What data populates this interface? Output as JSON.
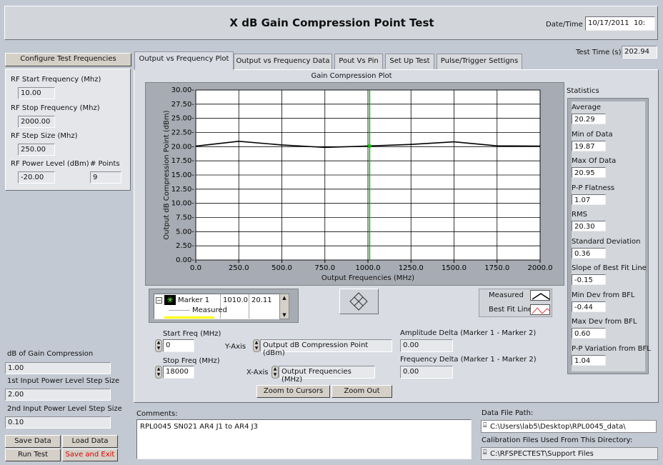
{
  "header": {
    "title": "X dB Gain Compression Point Test",
    "datetime_label": "Date/Time",
    "datetime_value": "10/17/2011  10:",
    "test_time_label": "Test Time (s)",
    "test_time_value": "202.94"
  },
  "config": {
    "button": "Configure Test Frequencies",
    "rf_start_label": "RF Start Frequency (Mhz)",
    "rf_start_value": "10.00",
    "rf_stop_label": "RF Stop Frequency (Mhz)",
    "rf_stop_value": "2000.00",
    "rf_step_label": "RF Step Size (Mhz)",
    "rf_step_value": "250.00",
    "rf_power_label": "RF Power Level (dBm)",
    "rf_power_value": "-20.00",
    "points_label": "# Points",
    "points_value": "9"
  },
  "tabs": [
    {
      "label": "Output vs Frequency Plot"
    },
    {
      "label": "Output vs Frequency Data"
    },
    {
      "label": "Pout Vs Pin"
    },
    {
      "label": "Set Up Test"
    },
    {
      "label": "Pulse/Trigger Settigns"
    }
  ],
  "plot": {
    "title": "Gain Compression Plot",
    "cursor_x": 1010
  },
  "chart_data": {
    "type": "line",
    "title": "Gain Compression Plot",
    "xlabel": "Output Frequencies (MHz)",
    "ylabel": "Output dB Compression Point (dBm)",
    "xlim": [
      0,
      2000
    ],
    "ylim": [
      0,
      30
    ],
    "x_ticks": [
      "0.0",
      "250.0",
      "500.0",
      "750.0",
      "1000.0",
      "1250.0",
      "1500.0",
      "1750.0",
      "2000.0"
    ],
    "y_ticks": [
      "0.00-",
      "2.50-",
      "5.00-",
      "7.50-",
      "10.00-",
      "12.50-",
      "15.00-",
      "17.50-",
      "20.00-",
      "22.50-",
      "25.00-",
      "27.50-",
      "30.00-"
    ],
    "grid": true,
    "series": [
      {
        "name": "Measured",
        "color": "#000000",
        "x": [
          0,
          250,
          500,
          750,
          1000,
          1250,
          1500,
          1750,
          2000
        ],
        "y": [
          20.1,
          20.95,
          20.3,
          19.87,
          20.11,
          20.4,
          20.85,
          20.15,
          20.1
        ]
      }
    ]
  },
  "marker_list": {
    "name": "Marker 1",
    "x": "1010.0",
    "y": "20.11",
    "sub": "Measured"
  },
  "legend": {
    "measured": "Measured",
    "bestfit": "Best Fit Line"
  },
  "controls": {
    "start_freq_label": "Start Freq (MHz)",
    "start_freq_value": "0",
    "stop_freq_label": "Stop Freq (MHz)",
    "stop_freq_value": "18000",
    "yaxis_label": "Y-Axis",
    "yaxis_value": "Output dB Compression Point (dBm)",
    "xaxis_label": "X-Axis",
    "xaxis_value": "Output Frequencies (MHz)",
    "amp_delta_label": "Amplitude Delta (Marker 1 - Marker 2)",
    "amp_delta_value": "0.00",
    "freq_delta_label": "Frequency Delta (Marker 1 - Marker 2)",
    "freq_delta_value": "0.00",
    "zoom_cursors": "Zoom to Cursors",
    "zoom_out": "Zoom Out"
  },
  "statistics": {
    "title": "Statistics",
    "items": [
      {
        "label": "Average",
        "value": "20.29"
      },
      {
        "label": "Min of Data",
        "value": "19.87"
      },
      {
        "label": "Max Of Data",
        "value": "20.95"
      },
      {
        "label": "P-P Flatness",
        "value": "1.07"
      },
      {
        "label": "RMS",
        "value": "20.30"
      },
      {
        "label": "Standard Deviation",
        "value": "0.36"
      },
      {
        "label": "Slope of Best Fit Line",
        "value": "-0.15"
      },
      {
        "label": "Min Dev from BFL",
        "value": "-0.44"
      },
      {
        "label": "Max Dev from BFL",
        "value": "0.60"
      },
      {
        "label": "P-P Variation from BFL",
        "value": "1.04"
      }
    ]
  },
  "left_bottom": {
    "db_gain_label": "dB of Gain Compression",
    "db_gain_value": "1.00",
    "step1_label": "1st Input Power Level Step Size",
    "step1_value": "2.00",
    "step2_label": "2nd Input Power Level Step Size",
    "step2_value": "0.10"
  },
  "buttons": {
    "save_data": "Save Data",
    "load_data": "Load Data",
    "run_test": "Run Test",
    "save_exit": "Save and Exit"
  },
  "comments": {
    "label": "Comments:",
    "value": "RPL0045 SN021 AR4 J1 to AR4 J3"
  },
  "paths": {
    "data_label": "Data File Path:",
    "data_value": "C:\\Users\\lab5\\Desktop\\RPL0045_data\\",
    "cal_label": "Calibration Files Used From This Directory:",
    "cal_value": "C:\\RFSPECTEST\\Support Files"
  },
  "colors": {
    "background": "#c3c9d2",
    "cursor": "#00c000",
    "save_exit_text": "#e00000",
    "marker_highlight": "#ffff00"
  }
}
